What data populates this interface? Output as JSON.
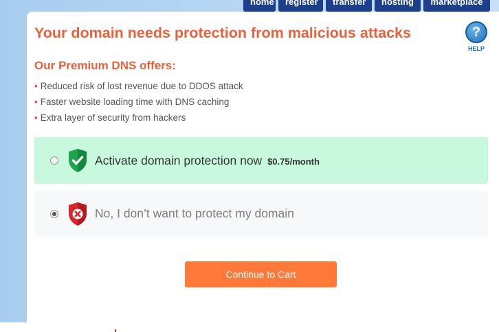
{
  "nav": {
    "items": [
      "home",
      "register",
      "transfer",
      "hosting",
      "marketplace"
    ]
  },
  "page": {
    "title": "Your domain needs protection from malicious attacks",
    "subtitle": "Our Premium DNS offers:"
  },
  "help": {
    "label": "HELP",
    "icon": "question-icon"
  },
  "features": [
    "Reduced risk of lost revenue due to DDOS attack",
    "Faster website loading time with DNS caching",
    "Extra layer of security from hackers"
  ],
  "options": {
    "activate": {
      "label": "Activate domain protection now",
      "price": "$0.75/month",
      "selected": false,
      "icon": "shield-check-icon"
    },
    "decline": {
      "label": "No, I don’t want to protect my domain",
      "selected": true,
      "icon": "shield-x-icon"
    }
  },
  "cta": {
    "label": "Continue to Cart"
  },
  "colors": {
    "accent": "#e8623d",
    "nav": "#1d3f8c",
    "cta": "#ff7a3a",
    "protect_bg": "#c8f9de",
    "shield_green": "#1ea54c",
    "shield_red": "#d9262c"
  }
}
